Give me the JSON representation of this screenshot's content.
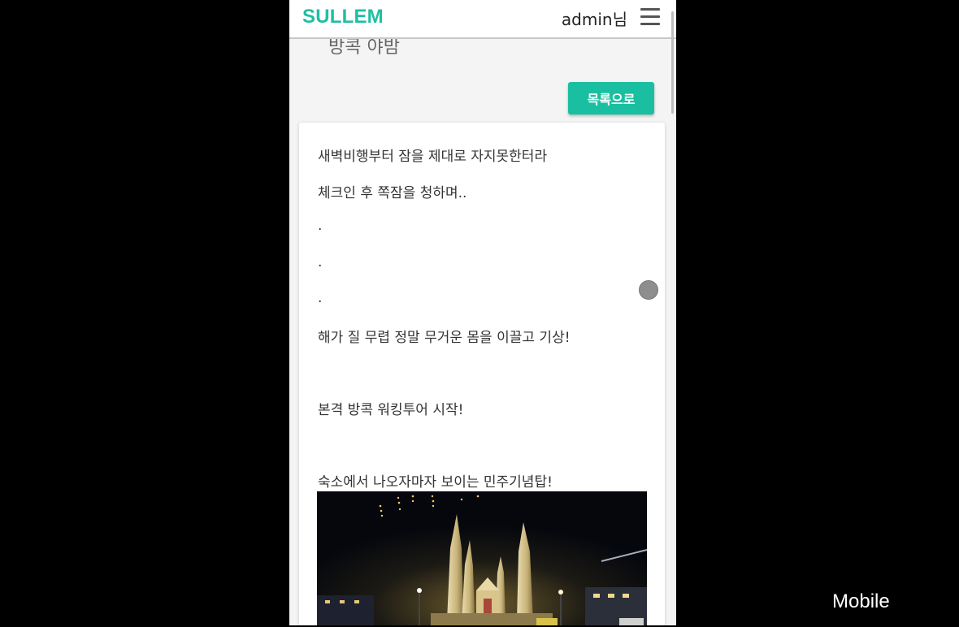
{
  "header": {
    "brand": "SULLEM",
    "user_label": "admin님",
    "menu_icon": "hamburger-menu-icon"
  },
  "post": {
    "title": "방콕 야밤",
    "list_button": "목록으로",
    "paragraphs": [
      "새벽비행부터 잠을 제대로 자지못한터라",
      "체크인 후 쪽잠을 청하며..",
      ".",
      ".",
      ".",
      "해가 질 무렵 정말 무거운 몸을 이끌고 기상!",
      "본격 방콕 워킹투어 시작!",
      "숙소에서 나오자마자 보이는 민주기념탑!"
    ],
    "image_subject": "democracy-monument-night-photo"
  },
  "overlay": {
    "mode_label": "Mobile"
  },
  "colors": {
    "brand": "#1fbfa2",
    "button": "#19bfa0",
    "backdrop": "#000000"
  }
}
